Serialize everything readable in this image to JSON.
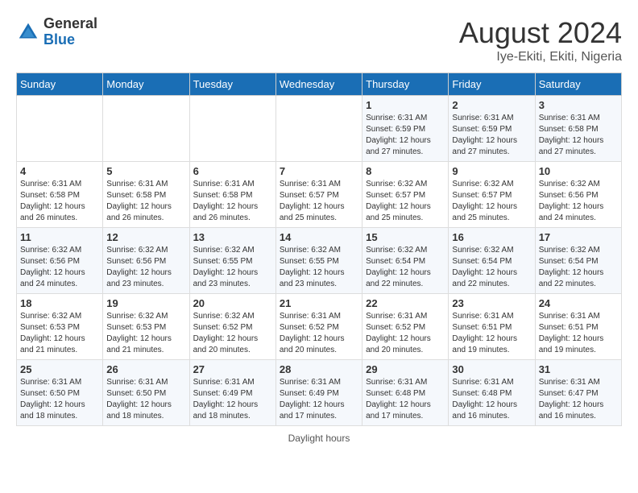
{
  "header": {
    "logo_general": "General",
    "logo_blue": "Blue",
    "title": "August 2024",
    "subtitle": "Iye-Ekiti, Ekiti, Nigeria"
  },
  "days_of_week": [
    "Sunday",
    "Monday",
    "Tuesday",
    "Wednesday",
    "Thursday",
    "Friday",
    "Saturday"
  ],
  "weeks": [
    [
      {
        "day": "",
        "info": ""
      },
      {
        "day": "",
        "info": ""
      },
      {
        "day": "",
        "info": ""
      },
      {
        "day": "",
        "info": ""
      },
      {
        "day": "1",
        "info": "Sunrise: 6:31 AM\nSunset: 6:59 PM\nDaylight: 12 hours\nand 27 minutes."
      },
      {
        "day": "2",
        "info": "Sunrise: 6:31 AM\nSunset: 6:59 PM\nDaylight: 12 hours\nand 27 minutes."
      },
      {
        "day": "3",
        "info": "Sunrise: 6:31 AM\nSunset: 6:58 PM\nDaylight: 12 hours\nand 27 minutes."
      }
    ],
    [
      {
        "day": "4",
        "info": "Sunrise: 6:31 AM\nSunset: 6:58 PM\nDaylight: 12 hours\nand 26 minutes."
      },
      {
        "day": "5",
        "info": "Sunrise: 6:31 AM\nSunset: 6:58 PM\nDaylight: 12 hours\nand 26 minutes."
      },
      {
        "day": "6",
        "info": "Sunrise: 6:31 AM\nSunset: 6:58 PM\nDaylight: 12 hours\nand 26 minutes."
      },
      {
        "day": "7",
        "info": "Sunrise: 6:31 AM\nSunset: 6:57 PM\nDaylight: 12 hours\nand 25 minutes."
      },
      {
        "day": "8",
        "info": "Sunrise: 6:32 AM\nSunset: 6:57 PM\nDaylight: 12 hours\nand 25 minutes."
      },
      {
        "day": "9",
        "info": "Sunrise: 6:32 AM\nSunset: 6:57 PM\nDaylight: 12 hours\nand 25 minutes."
      },
      {
        "day": "10",
        "info": "Sunrise: 6:32 AM\nSunset: 6:56 PM\nDaylight: 12 hours\nand 24 minutes."
      }
    ],
    [
      {
        "day": "11",
        "info": "Sunrise: 6:32 AM\nSunset: 6:56 PM\nDaylight: 12 hours\nand 24 minutes."
      },
      {
        "day": "12",
        "info": "Sunrise: 6:32 AM\nSunset: 6:56 PM\nDaylight: 12 hours\nand 23 minutes."
      },
      {
        "day": "13",
        "info": "Sunrise: 6:32 AM\nSunset: 6:55 PM\nDaylight: 12 hours\nand 23 minutes."
      },
      {
        "day": "14",
        "info": "Sunrise: 6:32 AM\nSunset: 6:55 PM\nDaylight: 12 hours\nand 23 minutes."
      },
      {
        "day": "15",
        "info": "Sunrise: 6:32 AM\nSunset: 6:54 PM\nDaylight: 12 hours\nand 22 minutes."
      },
      {
        "day": "16",
        "info": "Sunrise: 6:32 AM\nSunset: 6:54 PM\nDaylight: 12 hours\nand 22 minutes."
      },
      {
        "day": "17",
        "info": "Sunrise: 6:32 AM\nSunset: 6:54 PM\nDaylight: 12 hours\nand 22 minutes."
      }
    ],
    [
      {
        "day": "18",
        "info": "Sunrise: 6:32 AM\nSunset: 6:53 PM\nDaylight: 12 hours\nand 21 minutes."
      },
      {
        "day": "19",
        "info": "Sunrise: 6:32 AM\nSunset: 6:53 PM\nDaylight: 12 hours\nand 21 minutes."
      },
      {
        "day": "20",
        "info": "Sunrise: 6:32 AM\nSunset: 6:52 PM\nDaylight: 12 hours\nand 20 minutes."
      },
      {
        "day": "21",
        "info": "Sunrise: 6:31 AM\nSunset: 6:52 PM\nDaylight: 12 hours\nand 20 minutes."
      },
      {
        "day": "22",
        "info": "Sunrise: 6:31 AM\nSunset: 6:52 PM\nDaylight: 12 hours\nand 20 minutes."
      },
      {
        "day": "23",
        "info": "Sunrise: 6:31 AM\nSunset: 6:51 PM\nDaylight: 12 hours\nand 19 minutes."
      },
      {
        "day": "24",
        "info": "Sunrise: 6:31 AM\nSunset: 6:51 PM\nDaylight: 12 hours\nand 19 minutes."
      }
    ],
    [
      {
        "day": "25",
        "info": "Sunrise: 6:31 AM\nSunset: 6:50 PM\nDaylight: 12 hours\nand 18 minutes."
      },
      {
        "day": "26",
        "info": "Sunrise: 6:31 AM\nSunset: 6:50 PM\nDaylight: 12 hours\nand 18 minutes."
      },
      {
        "day": "27",
        "info": "Sunrise: 6:31 AM\nSunset: 6:49 PM\nDaylight: 12 hours\nand 18 minutes."
      },
      {
        "day": "28",
        "info": "Sunrise: 6:31 AM\nSunset: 6:49 PM\nDaylight: 12 hours\nand 17 minutes."
      },
      {
        "day": "29",
        "info": "Sunrise: 6:31 AM\nSunset: 6:48 PM\nDaylight: 12 hours\nand 17 minutes."
      },
      {
        "day": "30",
        "info": "Sunrise: 6:31 AM\nSunset: 6:48 PM\nDaylight: 12 hours\nand 16 minutes."
      },
      {
        "day": "31",
        "info": "Sunrise: 6:31 AM\nSunset: 6:47 PM\nDaylight: 12 hours\nand 16 minutes."
      }
    ]
  ],
  "footer": {
    "daylight_hours_label": "Daylight hours"
  }
}
